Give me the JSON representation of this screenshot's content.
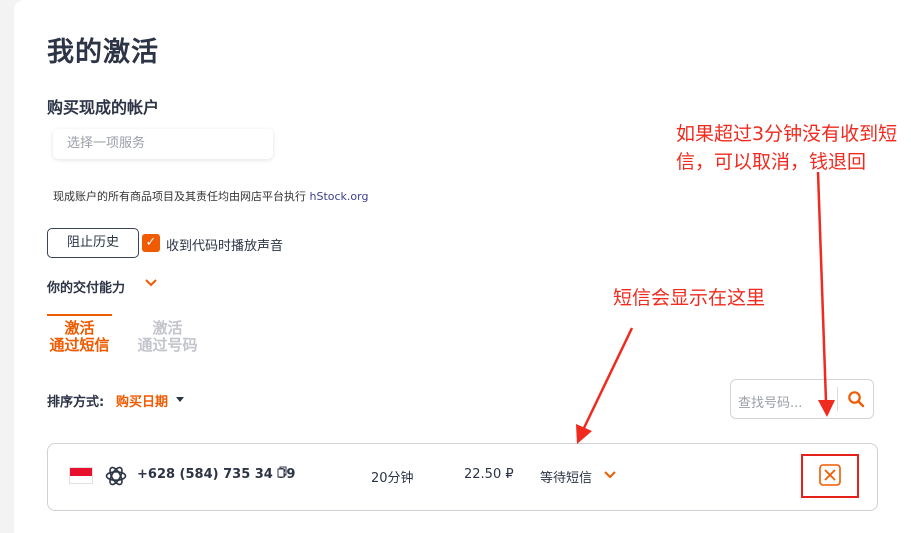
{
  "page": {
    "title": "我的激活"
  },
  "purchase": {
    "heading": "购买现成的帐户",
    "service_placeholder": "选择一项服务",
    "notice_text": "现成账户的所有商品项目及其责任均由网店平台执行 ",
    "notice_link": "hStock.org"
  },
  "controls": {
    "block_history": "阻止历史",
    "play_sound_label": "收到代码时播放声音",
    "play_sound_checked": true,
    "capacity_label": "你的交付能力"
  },
  "tabs": [
    {
      "line1": "激活",
      "line2": "通过短信",
      "active": true
    },
    {
      "line1": "激活",
      "line2": "通过号码",
      "active": false
    }
  ],
  "sort": {
    "label": "排序方式:",
    "value": "购买日期"
  },
  "search": {
    "placeholder": "查找号码..."
  },
  "activation": {
    "country": "Indonesia",
    "service_icon": "openai-icon",
    "phone": "+628 (584) 735 34 39",
    "duration": "20分钟",
    "price": "22.50 ₽",
    "status": "等待短信"
  },
  "annotations": {
    "cancel_note": "如果超过3分钟没有收到短信，可以取消，钱退回",
    "sms_note": "短信会显示在这里"
  },
  "colors": {
    "accent": "#f05a00",
    "annotation": "#f02a1e",
    "heading": "#2d3446"
  }
}
